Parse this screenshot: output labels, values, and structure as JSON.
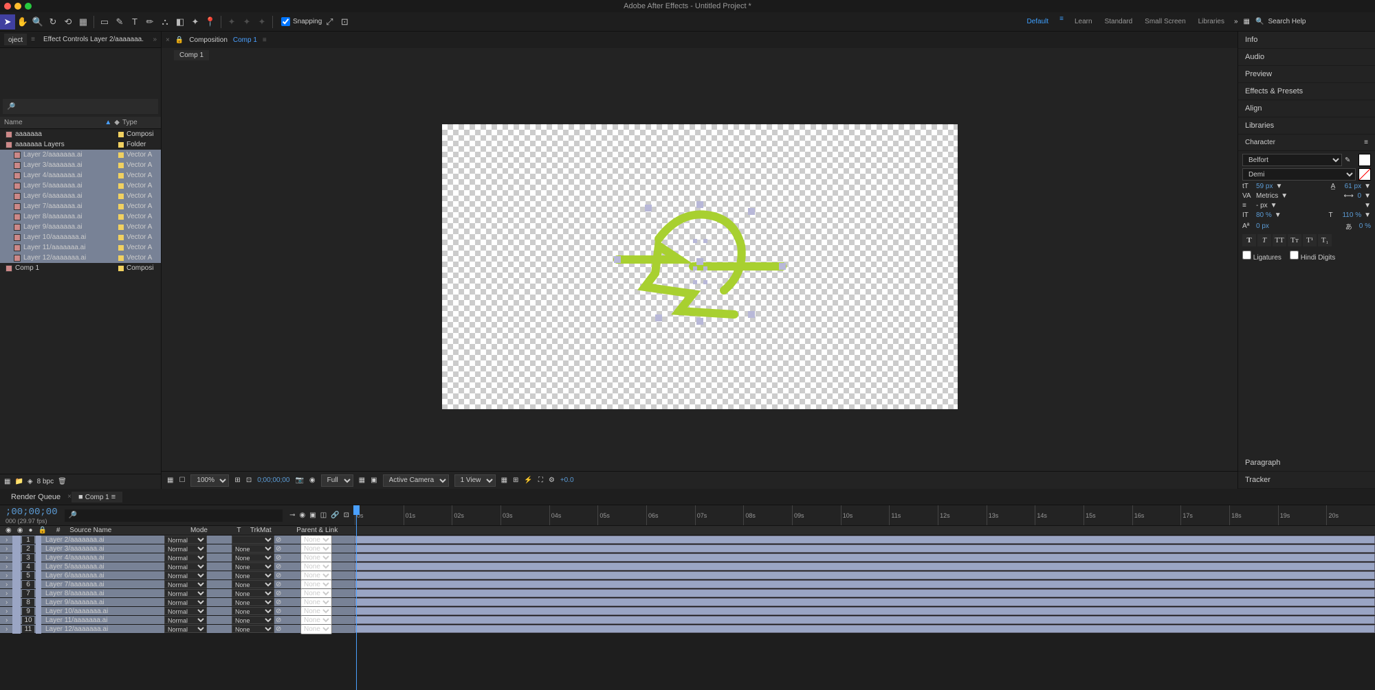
{
  "app": {
    "title": "Adobe After Effects - Untitled Project *"
  },
  "toolbar": {
    "snapping_label": "Snapping",
    "workspaces": [
      "Default",
      "Learn",
      "Standard",
      "Small Screen",
      "Libraries"
    ],
    "active_ws": 0,
    "search_placeholder": "Search Help"
  },
  "left_panel": {
    "tab1": "oject",
    "tab2": "Effect Controls Layer 2/aaaaaaa.",
    "col_name": "Name",
    "col_type": "Type",
    "items": [
      {
        "name": "aaaaaaa",
        "type": "Composi",
        "indent": 0,
        "sel": false
      },
      {
        "name": "aaaaaaa Layers",
        "type": "Folder",
        "indent": 0,
        "sel": false
      },
      {
        "name": "Layer 2/aaaaaaa.ai",
        "type": "Vector A",
        "indent": 1,
        "sel": true
      },
      {
        "name": "Layer 3/aaaaaaa.ai",
        "type": "Vector A",
        "indent": 1,
        "sel": true
      },
      {
        "name": "Layer 4/aaaaaaa.ai",
        "type": "Vector A",
        "indent": 1,
        "sel": true
      },
      {
        "name": "Layer 5/aaaaaaa.ai",
        "type": "Vector A",
        "indent": 1,
        "sel": true
      },
      {
        "name": "Layer 6/aaaaaaa.ai",
        "type": "Vector A",
        "indent": 1,
        "sel": true
      },
      {
        "name": "Layer 7/aaaaaaa.ai",
        "type": "Vector A",
        "indent": 1,
        "sel": true
      },
      {
        "name": "Layer 8/aaaaaaa.ai",
        "type": "Vector A",
        "indent": 1,
        "sel": true
      },
      {
        "name": "Layer 9/aaaaaaa.ai",
        "type": "Vector A",
        "indent": 1,
        "sel": true
      },
      {
        "name": "Layer 10/aaaaaaa.ai",
        "type": "Vector A",
        "indent": 1,
        "sel": true
      },
      {
        "name": "Layer 11/aaaaaaa.ai",
        "type": "Vector A",
        "indent": 1,
        "sel": true
      },
      {
        "name": "Layer 12/aaaaaaa.ai",
        "type": "Vector A",
        "indent": 1,
        "sel": true
      },
      {
        "name": "Comp 1",
        "type": "Composi",
        "indent": 0,
        "sel": false
      }
    ],
    "bpc": "8 bpc"
  },
  "composition": {
    "label": "Composition",
    "name": "Comp 1",
    "subtab": "Comp 1"
  },
  "viewer": {
    "zoom": "100%",
    "timecode": "0;00;00;00",
    "res": "Full",
    "camera": "Active Camera",
    "view": "1 View",
    "exposure": "+0.0"
  },
  "right": {
    "panels": [
      "Info",
      "Audio",
      "Preview",
      "Effects & Presets",
      "Align",
      "Libraries",
      "Character",
      "Paragraph",
      "Tracker"
    ],
    "font": "Belfort",
    "style": "Demi",
    "size": "59 px",
    "leading": "61 px",
    "kerning": "Metrics",
    "tracking": "0",
    "stroke": "- px",
    "vscale": "80 %",
    "hscale": "110 %",
    "baseline": "0 px",
    "tsume": "0 %",
    "ligatures": "Ligatures",
    "hindi": "Hindi Digits"
  },
  "timeline": {
    "tab1": "Render Queue",
    "tab2": "Comp 1",
    "timecode": ";00;00;00",
    "fps": "000 (29.97 fps)",
    "col_num": "#",
    "col_source": "Source Name",
    "col_mode": "Mode",
    "col_trk": "TrkMat",
    "col_parent": "Parent & Link",
    "ruler": [
      "0s",
      "01s",
      "02s",
      "03s",
      "04s",
      "05s",
      "06s",
      "07s",
      "08s",
      "09s",
      "10s",
      "11s",
      "12s",
      "13s",
      "14s",
      "15s",
      "16s",
      "17s",
      "18s",
      "19s",
      "20s"
    ],
    "layers": [
      {
        "n": 1,
        "name": "Layer 2/aaaaaaa.ai",
        "mode": "Normal",
        "trk": "",
        "parent": "None"
      },
      {
        "n": 2,
        "name": "Layer 3/aaaaaaa.ai",
        "mode": "Normal",
        "trk": "None",
        "parent": "None"
      },
      {
        "n": 3,
        "name": "Layer 4/aaaaaaa.ai",
        "mode": "Normal",
        "trk": "None",
        "parent": "None"
      },
      {
        "n": 4,
        "name": "Layer 5/aaaaaaa.ai",
        "mode": "Normal",
        "trk": "None",
        "parent": "None"
      },
      {
        "n": 5,
        "name": "Layer 6/aaaaaaa.ai",
        "mode": "Normal",
        "trk": "None",
        "parent": "None"
      },
      {
        "n": 6,
        "name": "Layer 7/aaaaaaa.ai",
        "mode": "Normal",
        "trk": "None",
        "parent": "None"
      },
      {
        "n": 7,
        "name": "Layer 8/aaaaaaa.ai",
        "mode": "Normal",
        "trk": "None",
        "parent": "None"
      },
      {
        "n": 8,
        "name": "Layer 9/aaaaaaa.ai",
        "mode": "Normal",
        "trk": "None",
        "parent": "None"
      },
      {
        "n": 9,
        "name": "Layer 10/aaaaaaa.ai",
        "mode": "Normal",
        "trk": "None",
        "parent": "None"
      },
      {
        "n": 10,
        "name": "Layer 11/aaaaaaa.ai",
        "mode": "Normal",
        "trk": "None",
        "parent": "None"
      },
      {
        "n": 11,
        "name": "Layer 12/aaaaaaa.ai",
        "mode": "Normal",
        "trk": "None",
        "parent": "None"
      }
    ]
  }
}
